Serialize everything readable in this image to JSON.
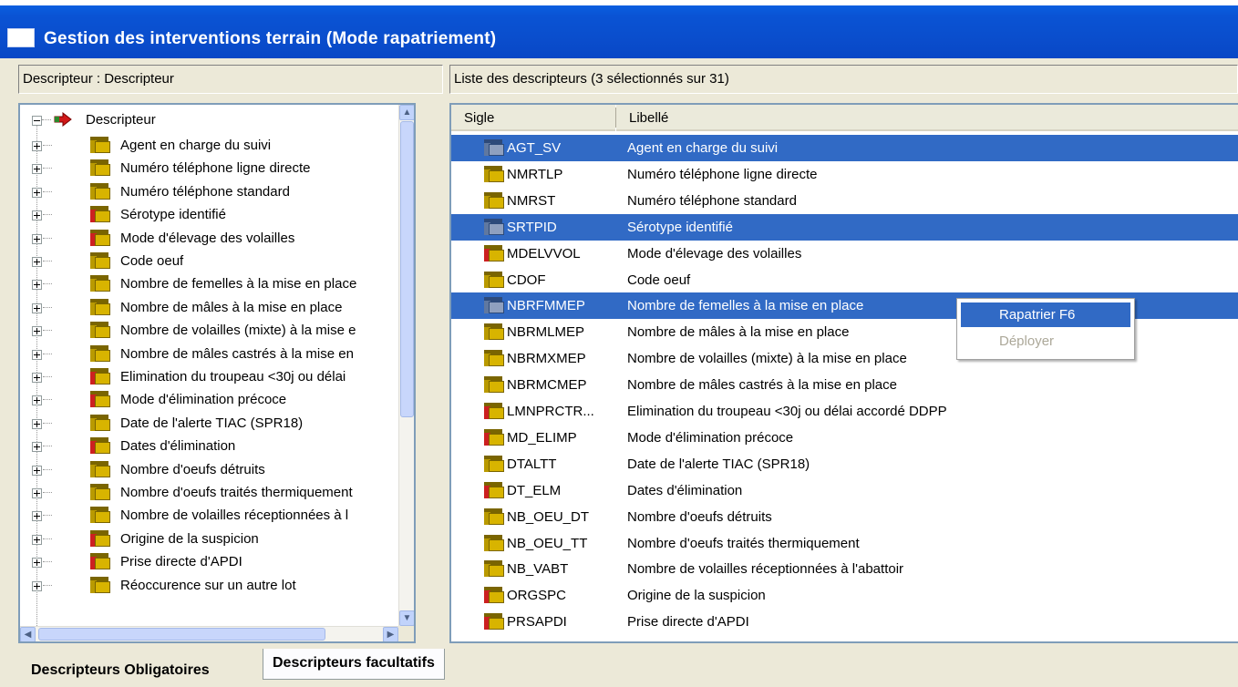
{
  "window": {
    "title": "Gestion des interventions terrain (Mode rapatriement)"
  },
  "left_header": "Descripteur : Descripteur",
  "right_header": "Liste des descripteurs  (3 sélectionnés sur 31)",
  "tree": {
    "root_label": "Descripteur",
    "items": [
      {
        "label": "Agent en charge du suivi",
        "icon": "folder-icon"
      },
      {
        "label": "Numéro téléphone ligne directe",
        "icon": "folder-icon"
      },
      {
        "label": "Numéro téléphone standard",
        "icon": "folder-icon"
      },
      {
        "label": "Sérotype identifié",
        "icon": "folder-red-icon"
      },
      {
        "label": "Mode d'élevage des volailles",
        "icon": "folder-red-icon"
      },
      {
        "label": "Code oeuf",
        "icon": "folder-icon"
      },
      {
        "label": "Nombre de femelles à la mise en place",
        "icon": "folder-icon"
      },
      {
        "label": "Nombre de mâles à la mise en place",
        "icon": "folder-icon"
      },
      {
        "label": "Nombre de volailles (mixte) à la mise e",
        "icon": "folder-icon"
      },
      {
        "label": "Nombre de mâles castrés à la mise en",
        "icon": "folder-icon"
      },
      {
        "label": "Elimination  du troupeau <30j ou délai",
        "icon": "folder-red-icon"
      },
      {
        "label": "Mode d'élimination précoce",
        "icon": "folder-red-icon"
      },
      {
        "label": "Date de l'alerte TIAC (SPR18)",
        "icon": "folder-icon"
      },
      {
        "label": "Dates d'élimination",
        "icon": "folder-red-icon"
      },
      {
        "label": "Nombre d'oeufs détruits",
        "icon": "folder-icon"
      },
      {
        "label": "Nombre d'oeufs traités thermiquement",
        "icon": "folder-icon"
      },
      {
        "label": "Nombre de volailles réceptionnées à l",
        "icon": "folder-icon"
      },
      {
        "label": "Origine de la suspicion",
        "icon": "folder-red-icon"
      },
      {
        "label": "Prise directe d'APDI",
        "icon": "folder-red-icon"
      },
      {
        "label": "Réoccurence sur un autre lot",
        "icon": "folder-icon"
      }
    ]
  },
  "list": {
    "columns": {
      "sigle": "Sigle",
      "libelle": "Libellé"
    },
    "rows": [
      {
        "sigle": "AGT_SV",
        "libelle": "Agent en charge du suivi",
        "selected": true
      },
      {
        "sigle": "NMRTLP",
        "libelle": "Numéro téléphone ligne directe",
        "selected": false
      },
      {
        "sigle": "NMRST",
        "libelle": "Numéro téléphone standard",
        "selected": false
      },
      {
        "sigle": "SRTPID",
        "libelle": "Sérotype identifié",
        "selected": true
      },
      {
        "sigle": "MDELVVOL",
        "libelle": "Mode d'élevage des volailles",
        "selected": false
      },
      {
        "sigle": "CDOF",
        "libelle": "Code oeuf",
        "selected": false
      },
      {
        "sigle": "NBRFMMEP",
        "libelle": "Nombre de femelles à la mise en place",
        "selected": true
      },
      {
        "sigle": "NBRMLMEP",
        "libelle": "Nombre de mâles à la mise en place",
        "selected": false
      },
      {
        "sigle": "NBRMXMEP",
        "libelle": "Nombre de volailles (mixte) à la mise en place",
        "selected": false
      },
      {
        "sigle": "NBRMCMEP",
        "libelle": "Nombre de mâles castrés à la mise en place",
        "selected": false
      },
      {
        "sigle": "LMNPRCTR...",
        "libelle": "Elimination  du troupeau <30j ou délai accordé DDPP",
        "selected": false
      },
      {
        "sigle": "MD_ELIMP",
        "libelle": "Mode d'élimination précoce",
        "selected": false
      },
      {
        "sigle": "DTALTT",
        "libelle": "Date de l'alerte TIAC (SPR18)",
        "selected": false
      },
      {
        "sigle": "DT_ELM",
        "libelle": "Dates d'élimination",
        "selected": false
      },
      {
        "sigle": "NB_OEU_DT",
        "libelle": "Nombre d'oeufs détruits",
        "selected": false
      },
      {
        "sigle": "NB_OEU_TT",
        "libelle": "Nombre d'oeufs traités thermiquement",
        "selected": false
      },
      {
        "sigle": "NB_VABT",
        "libelle": "Nombre de volailles réceptionnées à l'abattoir",
        "selected": false
      },
      {
        "sigle": "ORGSPC",
        "libelle": "Origine de la suspicion",
        "selected": false
      },
      {
        "sigle": "PRSAPDI",
        "libelle": "Prise directe d'APDI",
        "selected": false
      }
    ]
  },
  "context_menu": {
    "items": [
      {
        "label": "Rapatrier  F6",
        "state": "active"
      },
      {
        "label": "Déployer",
        "state": "disabled"
      }
    ]
  },
  "tabs": [
    {
      "label": "Descripteurs Obligatoires",
      "active": true
    },
    {
      "label": "Descripteurs facultatifs",
      "active": false
    }
  ],
  "colors": {
    "titlebar": "#0a53d4",
    "selection": "#316ac5",
    "window_bg": "#ece9d8"
  }
}
